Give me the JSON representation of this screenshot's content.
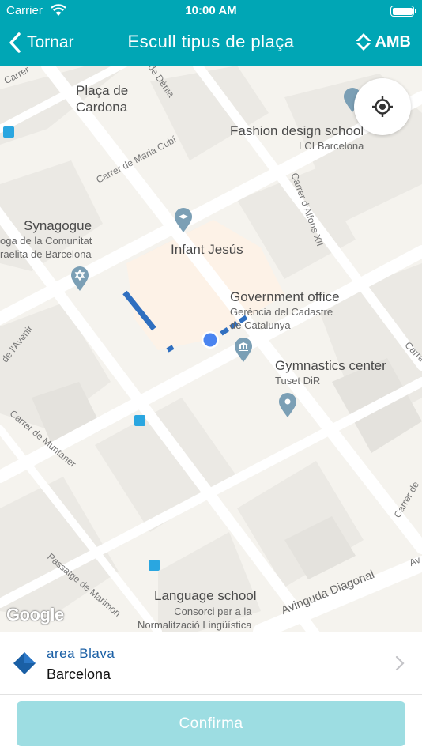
{
  "status_bar": {
    "carrier": "Carrier",
    "time": "10:00 AM"
  },
  "nav": {
    "back_label": "Tornar",
    "title": "Escull tipus de plaça",
    "brand": "AMB"
  },
  "map": {
    "pois": [
      {
        "name": "Plaça de Cardona"
      },
      {
        "name": "Fashion design school",
        "sub": "LCI Barcelona"
      },
      {
        "name": "Synagogue",
        "sub": "oga de la Comunitat\nraelita de Barcelona"
      },
      {
        "name": "Infant Jesús"
      },
      {
        "name": "Government office",
        "sub": "Gerència del Cadastre\nde Catalunya"
      },
      {
        "name": "Gymnastics center",
        "sub": "Tuset DiR"
      },
      {
        "name": "Language school",
        "sub": "Consorci per a la\nNormalització Lingüística"
      }
    ],
    "streets": [
      "Carrer",
      "de Dènia",
      "Carrer de Maria Cubí",
      "Carrer d'Alfons XII",
      "de l'Avenir",
      "Carrer de Muntaner",
      "Passatge de Marimon",
      "Avinguda Diagonal",
      "Carrer de",
      "Carre",
      "Av",
      "Carrer d"
    ],
    "attribution": "Google"
  },
  "zone": {
    "name": "area Blava",
    "city": "Barcelona",
    "color": "#1a5fa5"
  },
  "footer": {
    "confirm_label": "Confirma"
  },
  "colors": {
    "header": "#00a6b5",
    "confirm_disabled": "#9ddde2",
    "zone_blue": "#1a5fa5",
    "location_dot": "#4a84f0"
  }
}
